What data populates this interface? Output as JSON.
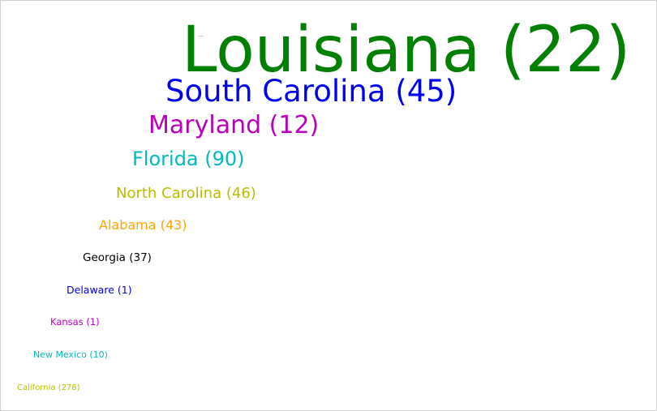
{
  "chart_data": {
    "type": "word_cloud",
    "items": [
      {
        "text": "Louisiana (22)",
        "color": "#008000"
      },
      {
        "text": "South Carolina (45)",
        "color": "#0000ee"
      },
      {
        "text": "Maryland (12)",
        "color": "#bb00bb"
      },
      {
        "text": "Florida (90)",
        "color": "#00bbbb"
      },
      {
        "text": "North Carolina (46)",
        "color": "#bbbb00"
      },
      {
        "text": "Alabama (43)",
        "color": "#ffa500"
      },
      {
        "text": "Georgia (37)",
        "color": "#000000"
      },
      {
        "text": "Delaware (1)",
        "color": "#0000ee"
      },
      {
        "text": "Kansas (1)",
        "color": "#bb00bb"
      },
      {
        "text": "New Mexico (10)",
        "color": "#00bbbb"
      },
      {
        "text": "California (278)",
        "color": "#bbbb00"
      }
    ]
  }
}
